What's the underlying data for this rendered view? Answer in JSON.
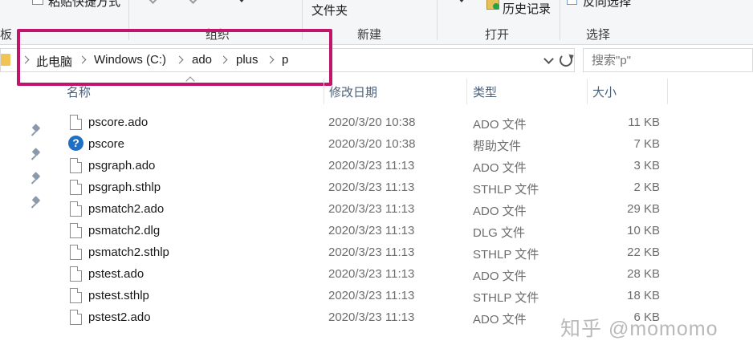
{
  "ribbon": {
    "paste_shortcut": "粘贴快捷方式",
    "folder_label": "文件夹",
    "history": "历史记录",
    "invert_select": "反向选择",
    "clipboard_group": "剪贴板",
    "organize_group": "组织",
    "new_group": "新建",
    "open_group": "打开",
    "select_group": "选择"
  },
  "address": {
    "crumbs": [
      "此电脑",
      "Windows (C:)",
      "ado",
      "plus",
      "p"
    ]
  },
  "search": {
    "placeholder": "搜索\"p\""
  },
  "columns": {
    "name": "名称",
    "date": "修改日期",
    "type": "类型",
    "size": "大小"
  },
  "files": [
    {
      "name": "pscore.ado",
      "date": "2020/3/20 10:38",
      "type": "ADO 文件",
      "size": "11 KB",
      "icon": "file-icon"
    },
    {
      "name": "pscore",
      "date": "2020/3/20 10:38",
      "type": "帮助文件",
      "size": "7 KB",
      "icon": "help-file-icon"
    },
    {
      "name": "psgraph.ado",
      "date": "2020/3/23 11:13",
      "type": "ADO 文件",
      "size": "3 KB",
      "icon": "file-icon"
    },
    {
      "name": "psgraph.sthlp",
      "date": "2020/3/23 11:13",
      "type": "STHLP 文件",
      "size": "2 KB",
      "icon": "file-icon"
    },
    {
      "name": "psmatch2.ado",
      "date": "2020/3/23 11:13",
      "type": "ADO 文件",
      "size": "29 KB",
      "icon": "file-icon"
    },
    {
      "name": "psmatch2.dlg",
      "date": "2020/3/23 11:13",
      "type": "DLG 文件",
      "size": "10 KB",
      "icon": "file-icon"
    },
    {
      "name": "psmatch2.sthlp",
      "date": "2020/3/23 11:13",
      "type": "STHLP 文件",
      "size": "22 KB",
      "icon": "file-icon"
    },
    {
      "name": "pstest.ado",
      "date": "2020/3/23 11:13",
      "type": "ADO 文件",
      "size": "28 KB",
      "icon": "file-icon"
    },
    {
      "name": "pstest.sthlp",
      "date": "2020/3/23 11:13",
      "type": "STHLP 文件",
      "size": "18 KB",
      "icon": "file-icon"
    },
    {
      "name": "pstest2.ado",
      "date": "2020/3/23 11:13",
      "type": "ADO 文件",
      "size": "6 KB",
      "icon": "file-icon"
    }
  ],
  "help_icon_glyph": "?",
  "watermark": "知乎 @momomo",
  "colors": {
    "highlight": "#c0156b",
    "help_icon": "#1f6fc5",
    "folder": "#f0c555"
  }
}
